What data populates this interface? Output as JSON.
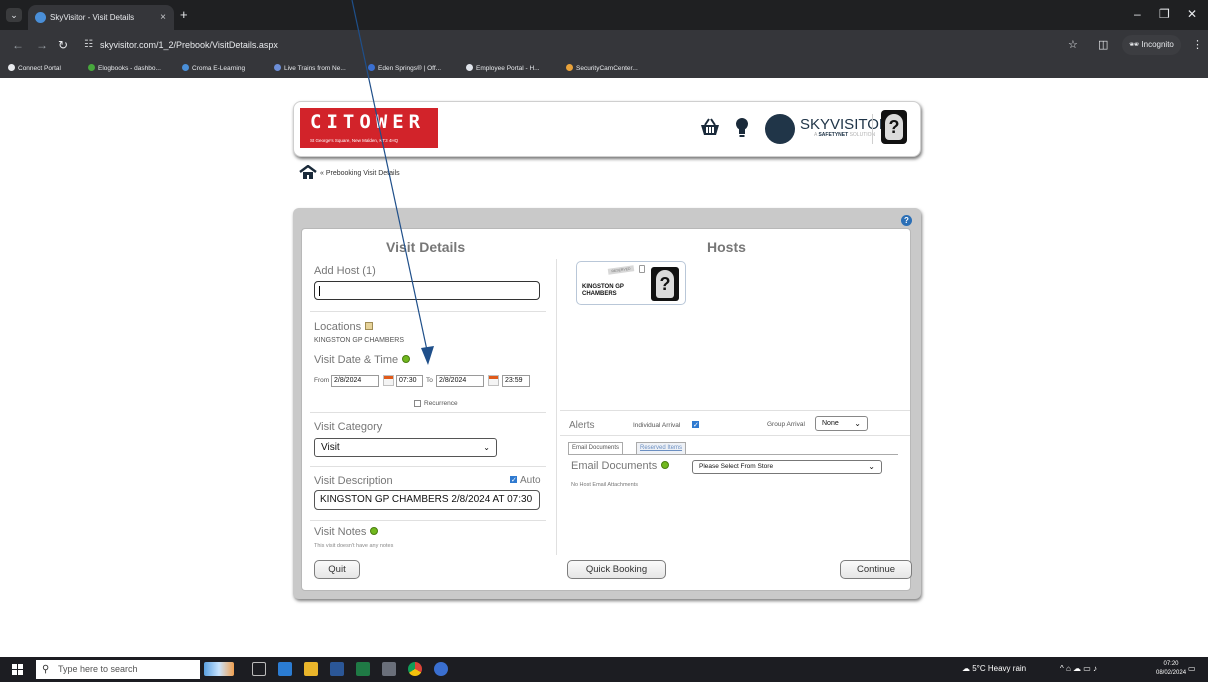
{
  "browser": {
    "tab_title": "SkyVisitor - Visit Details",
    "tab_close": "×",
    "new_tab": "+",
    "url": "skyvisitor.com/1_2/Prebook/VisitDetails.aspx",
    "incognito_label": "Incognito",
    "bookmarks": [
      {
        "label": "Connect Portal",
        "color": "#e8eaed"
      },
      {
        "label": "Elogbooks - dashbo...",
        "color": "#47a83c"
      },
      {
        "label": "Croma E-Learning",
        "color": "#4a8fd8"
      },
      {
        "label": "Live Trains from Ne...",
        "color": "#6d8fd8"
      },
      {
        "label": "Eden Springs® | Off...",
        "color": "#3a6fd0"
      },
      {
        "label": "Employee Portal - H...",
        "color": "#dfe3ea"
      },
      {
        "label": "SecurityCamCenter...",
        "color": "#e9a23a"
      }
    ]
  },
  "header": {
    "logo_title": "CITOWER",
    "logo_subtitle": "St George's Square, New Malden, KT3 4HQ",
    "brand_name": "SKYVISITOR",
    "brand_sub_prefix": "A ",
    "brand_sub_strong": "SAFETYNET",
    "brand_sub_suffix": " SOLUTION",
    "avatar_glyph": "?"
  },
  "breadcrumb": {
    "text": "« Prebooking Visit Details"
  },
  "visit_details": {
    "title": "Visit Details",
    "add_host_label": "Add Host (1)",
    "add_host_value": "",
    "locations_label": "Locations",
    "location_value": "KINGSTON GP CHAMBERS",
    "date_time_label": "Visit Date & Time",
    "from_label": "From",
    "from_date": "2/8/2024",
    "from_time": "07:30",
    "to_label": "To",
    "to_date": "2/8/2024",
    "to_time": "23:59",
    "recurrence_label": "Recurrence",
    "category_label": "Visit Category",
    "category_value": "Visit",
    "description_label": "Visit Description",
    "auto_label": "Auto",
    "description_value": "KINGSTON GP CHAMBERS 2/8/2024 AT 07:30",
    "notes_label": "Visit Notes",
    "notes_empty": "This visit doesn't have any notes"
  },
  "hosts": {
    "title": "Hosts",
    "host_card": {
      "stamp": "RESERVED",
      "name": "KINGSTON GP CHAMBERS",
      "avatar_glyph": "?"
    },
    "alerts_label": "Alerts",
    "individual_arrival_label": "Individual Arrival",
    "group_arrival_label": "Group Arrival",
    "group_arrival_value": "None",
    "tabs": [
      "Email Documents",
      "Reserved Items"
    ],
    "email_documents_label": "Email Documents",
    "store_select_value": "Please Select From Store",
    "no_attachments": "No Host Email Attachments"
  },
  "buttons": {
    "quit": "Quit",
    "quick_booking": "Quick Booking",
    "continue": "Continue"
  },
  "taskbar": {
    "search_placeholder": "Type here to search",
    "weather": "5°C  Heavy rain",
    "time": "07:20",
    "date": "08/02/2024"
  }
}
